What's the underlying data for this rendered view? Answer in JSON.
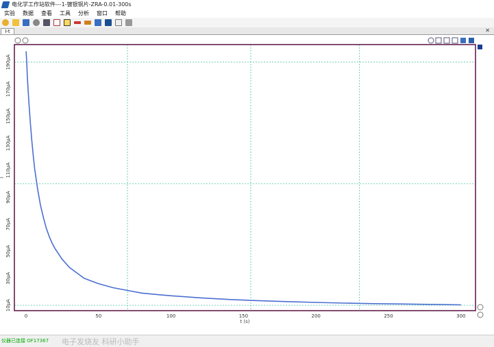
{
  "window": {
    "title": "电化学工作站软件---1-镀银铜片-ZRA-0.01-300s"
  },
  "menu": [
    "实验",
    "数据",
    "查看",
    "工具",
    "分析",
    "窗口",
    "帮助"
  ],
  "tab": {
    "label": "I-t",
    "close": "✕"
  },
  "toolbar_icons": [
    "new-experiment-icon",
    "open-folder-icon",
    "save-icon",
    "print-icon",
    "delete-icon",
    "chart-icon",
    "table-icon",
    "filter-icon",
    "peak-icon",
    "export-icon",
    "run-icon",
    "stop-icon",
    "pause-icon"
  ],
  "status": {
    "text": "仪器已连接 OF17367",
    "watermark": "电子发烧友 科研小助手"
  },
  "colors": {
    "series": "#4a6fd0",
    "frame": "#5a1040",
    "grid": "#44c0a0"
  },
  "chart_data": {
    "type": "line",
    "xlabel": "t (s)",
    "ylabel": "I",
    "xlim": [
      -8,
      310
    ],
    "ylim": [
      6,
      203
    ],
    "xticks": [
      0,
      50,
      100,
      150,
      200,
      250,
      300
    ],
    "yticks": [
      10,
      30,
      50,
      70,
      90,
      110,
      130,
      150,
      170,
      190
    ],
    "ytick_labels": [
      "10μA",
      "30μA",
      "50μA",
      "70μA",
      "90μA",
      "110μA",
      "130μA",
      "150μA",
      "170μA",
      "190μA"
    ],
    "x": [
      0.1,
      0.5,
      1,
      2,
      3,
      4,
      5,
      6,
      8,
      10,
      12,
      14,
      16,
      18,
      20,
      25,
      30,
      35,
      40,
      45,
      50,
      60,
      70,
      80,
      90,
      100,
      120,
      140,
      160,
      180,
      200,
      220,
      240,
      260,
      280,
      300
    ],
    "y": [
      198,
      190,
      178,
      160,
      145,
      132,
      121,
      111,
      96,
      84,
      75,
      67,
      61,
      56,
      52,
      44,
      38,
      34,
      30,
      28,
      26,
      23,
      21,
      19,
      18,
      17,
      15.5,
      14.3,
      13.4,
      12.7,
      12.1,
      11.6,
      11.2,
      10.9,
      10.6,
      10.3
    ],
    "grid": true,
    "legend": "none"
  }
}
